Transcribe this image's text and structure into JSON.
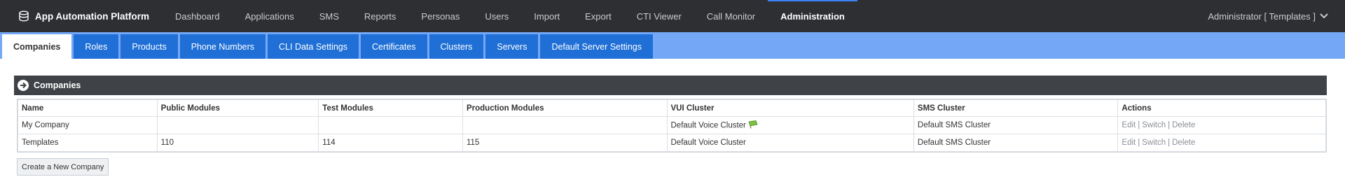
{
  "app": {
    "title": "App Automation Platform"
  },
  "nav": {
    "items": [
      {
        "label": "Dashboard",
        "active": false
      },
      {
        "label": "Applications",
        "active": false
      },
      {
        "label": "SMS",
        "active": false
      },
      {
        "label": "Reports",
        "active": false
      },
      {
        "label": "Personas",
        "active": false
      },
      {
        "label": "Users",
        "active": false
      },
      {
        "label": "Import",
        "active": false
      },
      {
        "label": "Export",
        "active": false
      },
      {
        "label": "CTI Viewer",
        "active": false
      },
      {
        "label": "Call Monitor",
        "active": false
      },
      {
        "label": "Administration",
        "active": true
      }
    ],
    "user": "Administrator [ Templates ]"
  },
  "tabs": [
    {
      "label": "Companies",
      "active": true
    },
    {
      "label": "Roles",
      "active": false
    },
    {
      "label": "Products",
      "active": false
    },
    {
      "label": "Phone Numbers",
      "active": false
    },
    {
      "label": "CLI Data Settings",
      "active": false
    },
    {
      "label": "Certificates",
      "active": false
    },
    {
      "label": "Clusters",
      "active": false
    },
    {
      "label": "Servers",
      "active": false
    },
    {
      "label": "Default Server Settings",
      "active": false
    }
  ],
  "panel": {
    "title": "Companies"
  },
  "table": {
    "headers": [
      "Name",
      "Public Modules",
      "Test Modules",
      "Production Modules",
      "VUI Cluster",
      "SMS Cluster",
      "Actions"
    ],
    "rows": [
      {
        "name": "My Company",
        "public": "",
        "test": "",
        "production": "",
        "vui": "Default Voice Cluster",
        "vui_flag": true,
        "sms": "Default SMS Cluster"
      },
      {
        "name": "Templates",
        "public": "110",
        "test": "114",
        "production": "115",
        "vui": "Default Voice Cluster",
        "vui_flag": false,
        "sms": "Default SMS Cluster"
      }
    ],
    "actions": {
      "edit": "Edit",
      "switch": "Switch",
      "delete": "Delete",
      "separator": "|"
    }
  },
  "create_button": "Create a New Company",
  "colors": {
    "topbar": "#2d2f33",
    "subbar": "#74a8f6",
    "tab": "#1f6fd6",
    "panel_header": "#3f4347"
  }
}
